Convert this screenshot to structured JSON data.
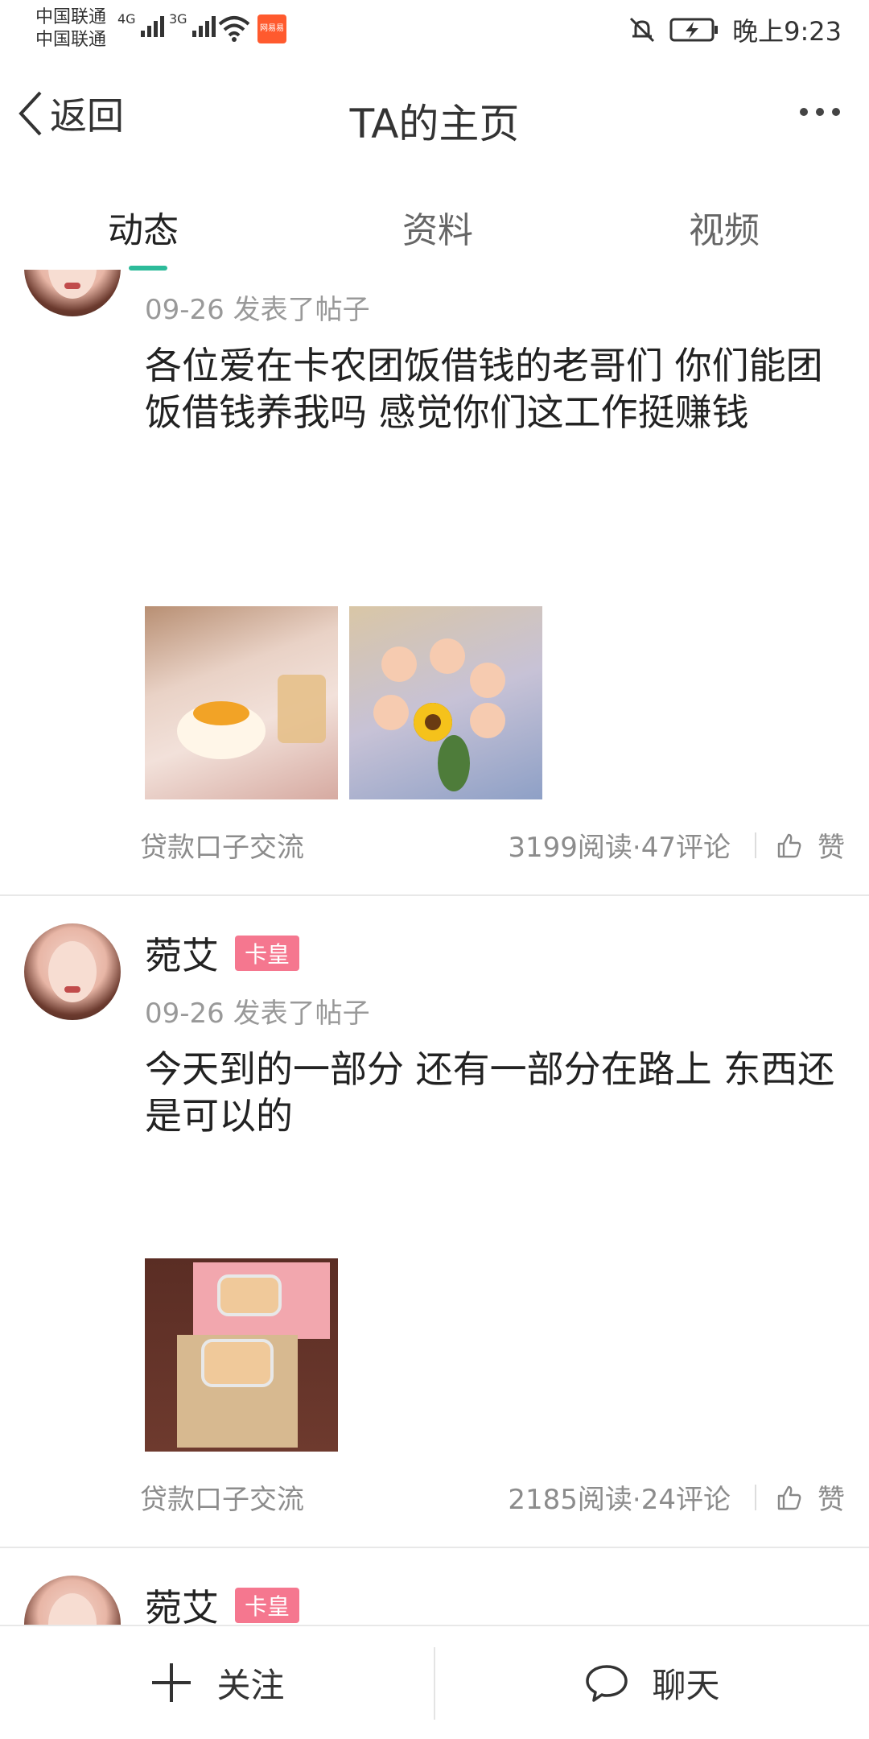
{
  "status_bar": {
    "carrier_1": "中国联通",
    "carrier_2": "中国联通",
    "network_1": "4G",
    "network_2": "3G",
    "app_badge": "网易易",
    "time": "晚上9:23"
  },
  "header": {
    "back_label": "返回",
    "title": "TA的主页"
  },
  "tabs": [
    {
      "label": "动态",
      "active": true
    },
    {
      "label": "资料",
      "active": false
    },
    {
      "label": "视频",
      "active": false
    }
  ],
  "posts": [
    {
      "date_action": "09-26  发表了帖子",
      "content": "各位爱在卡农团饭借钱的老哥们 你们能团饭借钱养我吗 感觉你们这工作挺赚钱",
      "tag": "贷款口子交流",
      "stats": "3199阅读·47评论",
      "like_label": "赞"
    },
    {
      "user_name": "菀艾",
      "badge": "卡皇",
      "date_action": "09-26  发表了帖子",
      "content": "今天到的一部分 还有一部分在路上 东西还是可以的",
      "tag": "贷款口子交流",
      "stats": "2185阅读·24评论",
      "like_label": "赞"
    },
    {
      "user_name": "菀艾",
      "badge": "卡皇"
    }
  ],
  "bottom_bar": {
    "follow_label": "关注",
    "chat_label": "聊天"
  },
  "colors": {
    "accent": "#2dbb9a",
    "badge": "#f5778f"
  }
}
